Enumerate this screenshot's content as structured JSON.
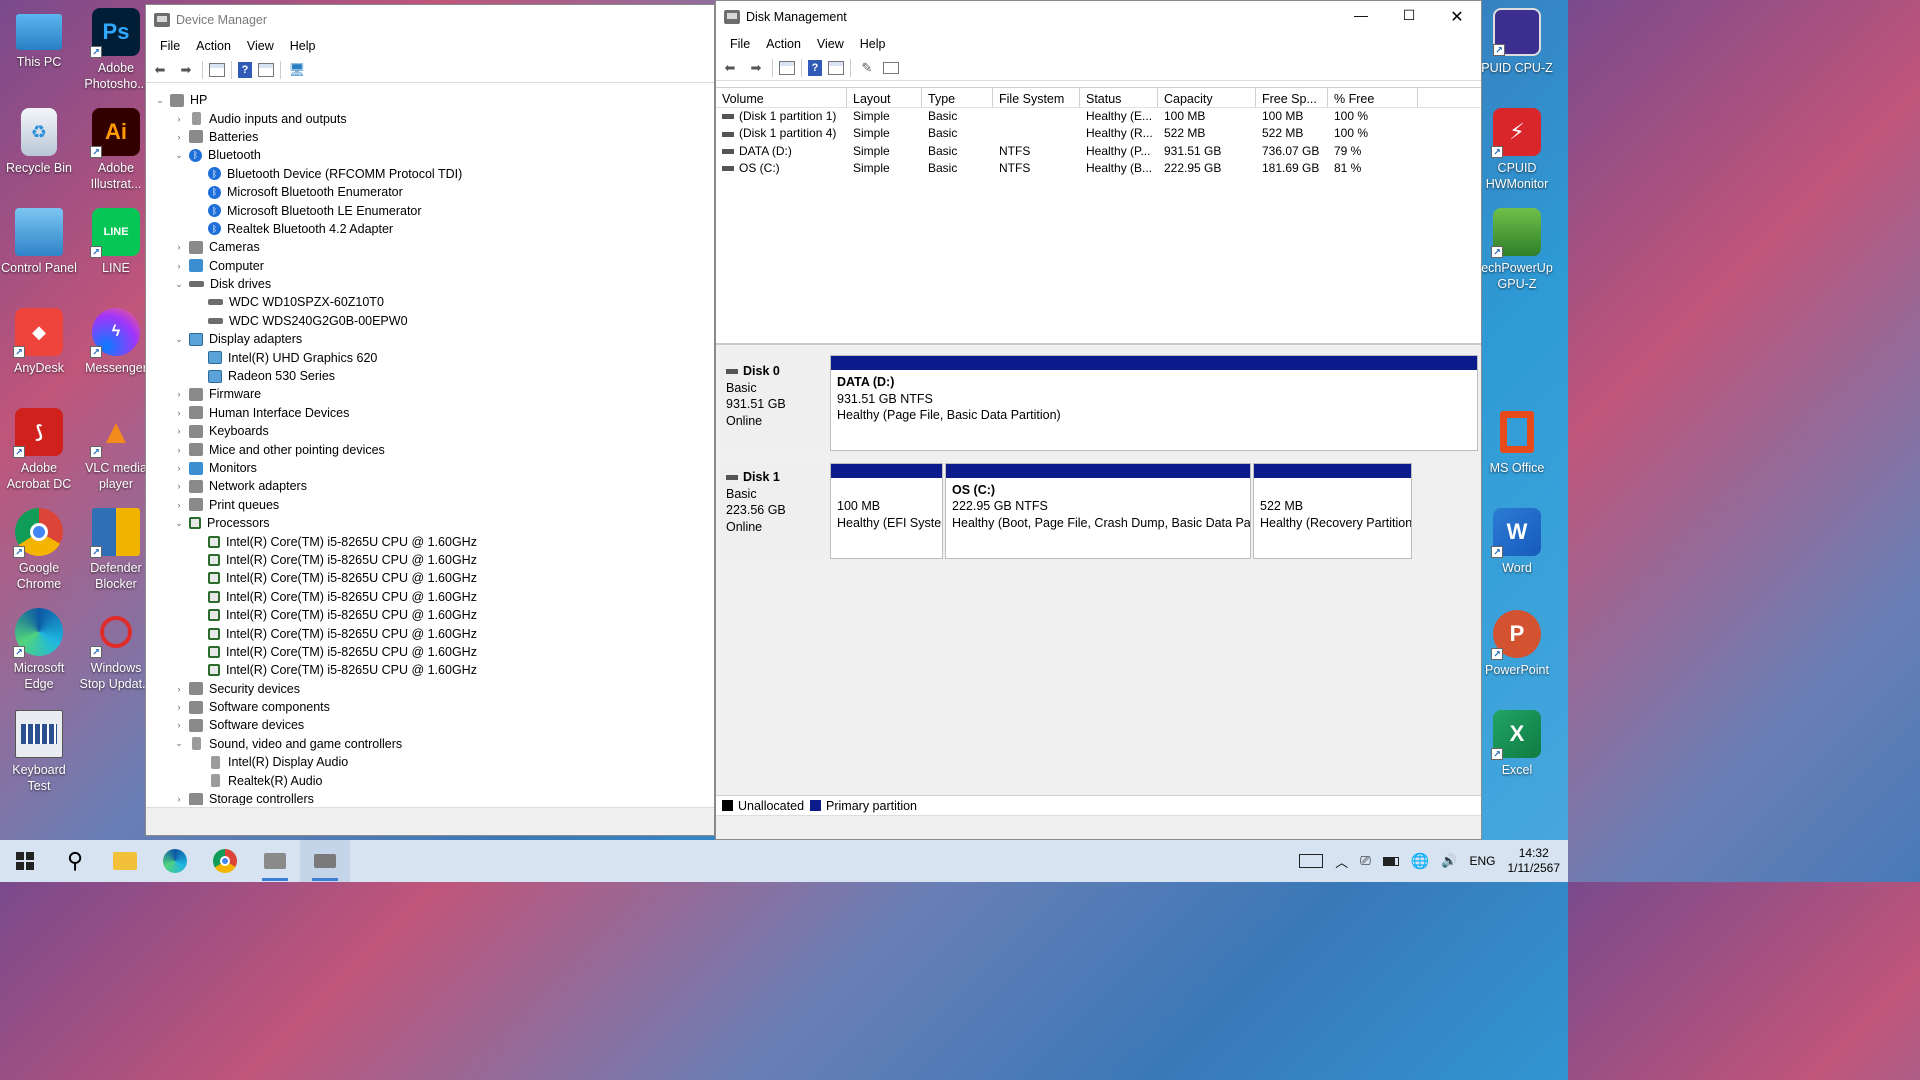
{
  "desktop": {
    "left_icons": [
      {
        "label": "This PC",
        "icon": "this-pc-icon"
      },
      {
        "label": "Adobe Photosho...",
        "icon": "photoshop-icon",
        "glyph": "Ps"
      },
      {
        "label": "Recycle Bin",
        "icon": "recycle-bin-icon"
      },
      {
        "label": "Adobe Illustrat...",
        "icon": "illustrator-icon",
        "glyph": "Ai"
      },
      {
        "label": "Control Panel",
        "icon": "control-panel-icon"
      },
      {
        "label": "LINE",
        "icon": "line-icon",
        "glyph": "LINE"
      },
      {
        "label": "AnyDesk",
        "icon": "anydesk-icon"
      },
      {
        "label": "Messenger",
        "icon": "messenger-icon"
      },
      {
        "label": "Adobe Acrobat DC",
        "icon": "acrobat-icon"
      },
      {
        "label": "VLC media player",
        "icon": "vlc-icon"
      },
      {
        "label": "Google Chrome",
        "icon": "chrome-icon"
      },
      {
        "label": "Defender Blocker",
        "icon": "defender-blocker-icon"
      },
      {
        "label": "Microsoft Edge",
        "icon": "edge-icon"
      },
      {
        "label": "Windows Stop Updat...",
        "icon": "windows-stop-update-icon"
      },
      {
        "label": "Keyboard Test",
        "icon": "keyboard-test-icon"
      }
    ],
    "right_icons": [
      {
        "label": "PUID CPU-Z",
        "icon": "cpuz-icon"
      },
      {
        "label": "CPUID HWMonitor",
        "icon": "hwmonitor-icon"
      },
      {
        "label": "echPowerUp GPU-Z",
        "icon": "gpuz-icon"
      },
      {
        "label": "MS Office",
        "icon": "ms-office-icon"
      },
      {
        "label": "Word",
        "icon": "word-icon",
        "glyph": "W"
      },
      {
        "label": "PowerPoint",
        "icon": "powerpoint-icon",
        "glyph": "P"
      },
      {
        "label": "Excel",
        "icon": "excel-icon",
        "glyph": "X"
      }
    ]
  },
  "device_manager": {
    "title": "Device Manager",
    "menu": [
      "File",
      "Action",
      "View",
      "Help"
    ],
    "tree": [
      {
        "label": "HP",
        "level": 0,
        "expander": "open",
        "icon": "computer-icon"
      },
      {
        "label": "Audio inputs and outputs",
        "level": 1,
        "expander": "closed",
        "icon": "speaker-icon"
      },
      {
        "label": "Batteries",
        "level": 1,
        "expander": "closed",
        "icon": "battery-icon"
      },
      {
        "label": "Bluetooth",
        "level": 1,
        "expander": "open",
        "icon": "bluetooth-icon"
      },
      {
        "label": "Bluetooth Device (RFCOMM Protocol TDI)",
        "level": 2,
        "icon": "bluetooth-icon"
      },
      {
        "label": "Microsoft Bluetooth Enumerator",
        "level": 2,
        "icon": "bluetooth-icon"
      },
      {
        "label": "Microsoft Bluetooth LE Enumerator",
        "level": 2,
        "icon": "bluetooth-icon"
      },
      {
        "label": "Realtek Bluetooth 4.2 Adapter",
        "level": 2,
        "icon": "bluetooth-icon"
      },
      {
        "label": "Cameras",
        "level": 1,
        "expander": "closed",
        "icon": "camera-icon"
      },
      {
        "label": "Computer",
        "level": 1,
        "expander": "closed",
        "icon": "monitor-icon"
      },
      {
        "label": "Disk drives",
        "level": 1,
        "expander": "open",
        "icon": "disk-drive-icon"
      },
      {
        "label": "WDC WD10SPZX-60Z10T0",
        "level": 2,
        "icon": "disk-drive-icon"
      },
      {
        "label": "WDC WDS240G2G0B-00EPW0",
        "level": 2,
        "icon": "disk-drive-icon"
      },
      {
        "label": "Display adapters",
        "level": 1,
        "expander": "open",
        "icon": "display-adapter-icon"
      },
      {
        "label": "Intel(R) UHD Graphics 620",
        "level": 2,
        "icon": "display-adapter-icon"
      },
      {
        "label": "Radeon 530 Series",
        "level": 2,
        "icon": "display-adapter-icon"
      },
      {
        "label": "Firmware",
        "level": 1,
        "expander": "closed",
        "icon": "firmware-icon"
      },
      {
        "label": "Human Interface Devices",
        "level": 1,
        "expander": "closed",
        "icon": "hid-icon"
      },
      {
        "label": "Keyboards",
        "level": 1,
        "expander": "closed",
        "icon": "keyboard-icon"
      },
      {
        "label": "Mice and other pointing devices",
        "level": 1,
        "expander": "closed",
        "icon": "mouse-icon"
      },
      {
        "label": "Monitors",
        "level": 1,
        "expander": "closed",
        "icon": "monitor-icon"
      },
      {
        "label": "Network adapters",
        "level": 1,
        "expander": "closed",
        "icon": "network-icon"
      },
      {
        "label": "Print queues",
        "level": 1,
        "expander": "closed",
        "icon": "printer-icon"
      },
      {
        "label": "Processors",
        "level": 1,
        "expander": "open",
        "icon": "processor-icon"
      },
      {
        "label": "Intel(R) Core(TM) i5-8265U CPU @ 1.60GHz",
        "level": 2,
        "icon": "processor-icon"
      },
      {
        "label": "Intel(R) Core(TM) i5-8265U CPU @ 1.60GHz",
        "level": 2,
        "icon": "processor-icon"
      },
      {
        "label": "Intel(R) Core(TM) i5-8265U CPU @ 1.60GHz",
        "level": 2,
        "icon": "processor-icon"
      },
      {
        "label": "Intel(R) Core(TM) i5-8265U CPU @ 1.60GHz",
        "level": 2,
        "icon": "processor-icon"
      },
      {
        "label": "Intel(R) Core(TM) i5-8265U CPU @ 1.60GHz",
        "level": 2,
        "icon": "processor-icon"
      },
      {
        "label": "Intel(R) Core(TM) i5-8265U CPU @ 1.60GHz",
        "level": 2,
        "icon": "processor-icon"
      },
      {
        "label": "Intel(R) Core(TM) i5-8265U CPU @ 1.60GHz",
        "level": 2,
        "icon": "processor-icon"
      },
      {
        "label": "Intel(R) Core(TM) i5-8265U CPU @ 1.60GHz",
        "level": 2,
        "icon": "processor-icon"
      },
      {
        "label": "Security devices",
        "level": 1,
        "expander": "closed",
        "icon": "security-icon"
      },
      {
        "label": "Software components",
        "level": 1,
        "expander": "closed",
        "icon": "software-component-icon"
      },
      {
        "label": "Software devices",
        "level": 1,
        "expander": "closed",
        "icon": "software-device-icon"
      },
      {
        "label": "Sound, video and game controllers",
        "level": 1,
        "expander": "open",
        "icon": "speaker-icon"
      },
      {
        "label": "Intel(R) Display Audio",
        "level": 2,
        "icon": "speaker-icon"
      },
      {
        "label": "Realtek(R) Audio",
        "level": 2,
        "icon": "speaker-icon"
      },
      {
        "label": "Storage controllers",
        "level": 1,
        "expander": "closed",
        "icon": "storage-controller-icon"
      }
    ]
  },
  "disk_management": {
    "title": "Disk Management",
    "menu": [
      "File",
      "Action",
      "View",
      "Help"
    ],
    "columns": [
      "Volume",
      "Layout",
      "Type",
      "File System",
      "Status",
      "Capacity",
      "Free Sp...",
      "% Free"
    ],
    "volumes": [
      [
        "(Disk 1 partition 1)",
        "Simple",
        "Basic",
        "",
        "Healthy (E...",
        "100 MB",
        "100 MB",
        "100 %"
      ],
      [
        "(Disk 1 partition 4)",
        "Simple",
        "Basic",
        "",
        "Healthy (R...",
        "522 MB",
        "522 MB",
        "100 %"
      ],
      [
        "DATA (D:)",
        "Simple",
        "Basic",
        "NTFS",
        "Healthy (P...",
        "931.51 GB",
        "736.07 GB",
        "79 %"
      ],
      [
        "OS (C:)",
        "Simple",
        "Basic",
        "NTFS",
        "Healthy (B...",
        "222.95 GB",
        "181.69 GB",
        "81 %"
      ]
    ],
    "disks": [
      {
        "name": "Disk 0",
        "type": "Basic",
        "size": "931.51 GB",
        "state": "Online",
        "partitions": [
          {
            "name": "DATA  (D:)",
            "size": "931.51 GB NTFS",
            "status": "Healthy (Page File, Basic Data Partition)"
          }
        ]
      },
      {
        "name": "Disk 1",
        "type": "Basic",
        "size": "223.56 GB",
        "state": "Online",
        "partitions": [
          {
            "name": "",
            "size": "100 MB",
            "status": "Healthy (EFI System Partition)"
          },
          {
            "name": "OS  (C:)",
            "size": "222.95 GB NTFS",
            "status": "Healthy (Boot, Page File, Crash Dump, Basic Data Partition)"
          },
          {
            "name": "",
            "size": "522 MB",
            "status": "Healthy (Recovery Partition)"
          }
        ]
      }
    ],
    "legend": [
      {
        "label": "Unallocated",
        "color": "#000000"
      },
      {
        "label": "Primary partition",
        "color": "#0b1b8c"
      }
    ]
  },
  "taskbar": {
    "items": [
      "start-icon",
      "search-icon",
      "file-explorer-icon",
      "edge-icon",
      "chrome-icon",
      "device-manager-icon",
      "disk-management-icon"
    ],
    "language": "ENG",
    "time": "14:32",
    "date": "1/11/2567"
  }
}
